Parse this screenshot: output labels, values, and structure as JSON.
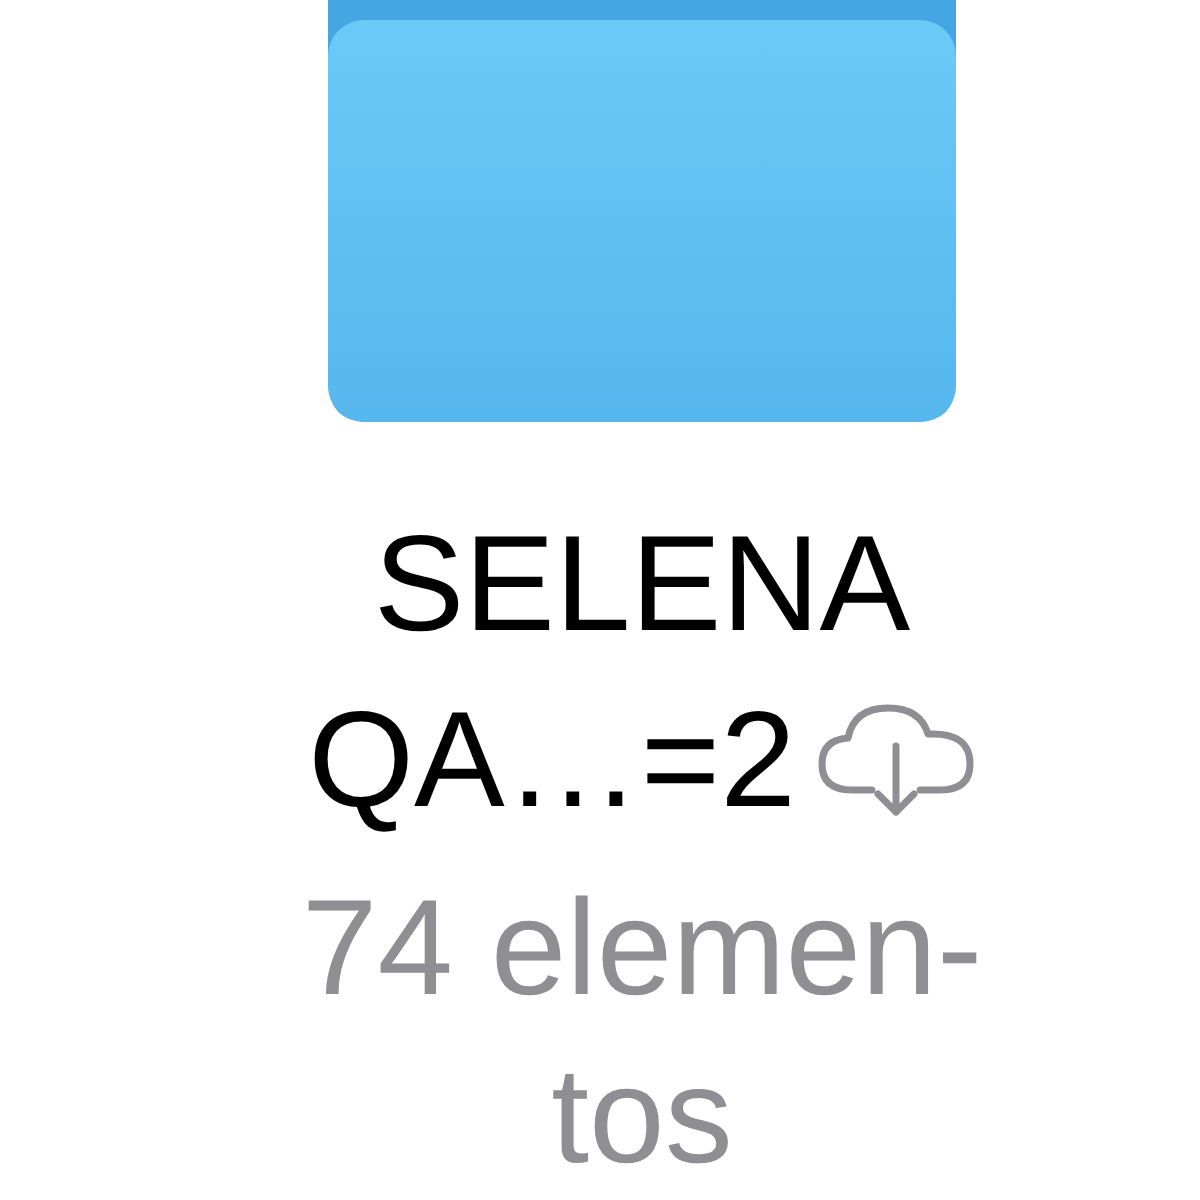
{
  "folder": {
    "name": "SELENA QA…=2",
    "cloud_download": true,
    "count": "74 elemen-tos"
  }
}
